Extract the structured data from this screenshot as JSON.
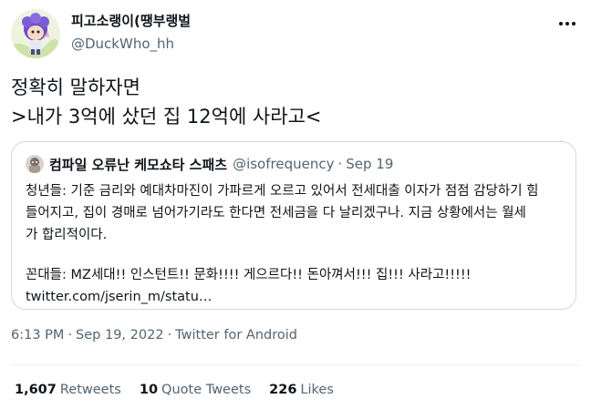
{
  "tweet": {
    "author": {
      "display_name": "피고소랭이(땡부랭벌",
      "handle": "@DuckWho_hh"
    },
    "text_lines": [
      "정확히 말하자면",
      ">내가 3억에 샀던 집 12억에 사라고<"
    ],
    "quoted": {
      "author_name": "컴파일 오류난 케모쇼타 스패츠",
      "handle": "@isofrequency",
      "separator": "·",
      "date": "Sep 19",
      "body_lines": [
        "청년들: 기준 금리와 예대차마진이 가파르게 오르고 있어서 전세대출 이자가 점점 감당하기 힘",
        "들어지고, 집이 경매로 넘어가기라도 한다면 전세금을 다 날리겠구나. 지금 상황에서는 월세",
        "가 합리적이다.",
        "꼰대들: MZ세대!! 인스턴트!! 문화!!!! 게으르다!! 돈아껴서!!! 집!!! 사라고!!!!!",
        "twitter.com/jserin_m/statu…"
      ]
    },
    "timestamp": {
      "time": "6:13 PM",
      "separator": "·",
      "date": "Sep 19, 2022",
      "separator2": "·",
      "source": "Twitter for Android"
    },
    "stats": {
      "retweets": {
        "count": "1,607",
        "label": "Retweets"
      },
      "quote_tweets": {
        "count": "10",
        "label": "Quote Tweets"
      },
      "likes": {
        "count": "226",
        "label": "Likes"
      }
    },
    "icons": {
      "more": "more-options-icon"
    },
    "colors": {
      "text": "#0f1419",
      "secondary": "#536471",
      "border": "#cfd9de",
      "divider": "#eff3f4"
    }
  }
}
